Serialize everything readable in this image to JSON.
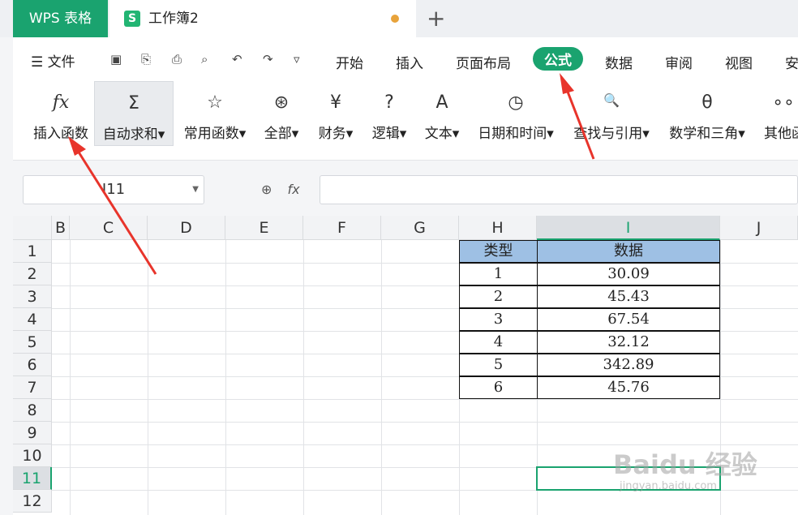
{
  "tabs": {
    "app": "WPS 表格",
    "doc_icon": "S",
    "doc": "工作簿2",
    "new_tab": "+"
  },
  "menubar": {
    "file": "☰ 文件",
    "items": [
      "开始",
      "插入",
      "页面布局",
      "公式",
      "数据",
      "审阅",
      "视图",
      "安"
    ]
  },
  "ribbon": [
    {
      "icon": "fx",
      "label": "插入函数"
    },
    {
      "icon": "Σ",
      "label": "自动求和▾"
    },
    {
      "icon": "☆",
      "label": "常用函数▾"
    },
    {
      "icon": "⊛",
      "label": "全部▾"
    },
    {
      "icon": "¥",
      "label": "财务▾"
    },
    {
      "icon": "?",
      "label": "逻辑▾"
    },
    {
      "icon": "A",
      "label": "文本▾"
    },
    {
      "icon": "◷",
      "label": "日期和时间▾"
    },
    {
      "icon": "🔍",
      "label": "查找与引用▾"
    },
    {
      "icon": "θ",
      "label": "数学和三角▾"
    },
    {
      "icon": "∘∘",
      "label": "其他函"
    }
  ],
  "formula_bar": {
    "name_box": "I11",
    "fx": "fx"
  },
  "columns": [
    "B",
    "C",
    "D",
    "E",
    "F",
    "G",
    "H",
    "I",
    "J"
  ],
  "rows": [
    "1",
    "2",
    "3",
    "4",
    "5",
    "6",
    "7",
    "8",
    "9",
    "10",
    "11",
    "12"
  ],
  "table": {
    "headers": [
      "类型",
      "数据"
    ],
    "rows": [
      [
        "1",
        "30.09"
      ],
      [
        "2",
        "45.43"
      ],
      [
        "3",
        "67.54"
      ],
      [
        "4",
        "32.12"
      ],
      [
        "5",
        "342.89"
      ],
      [
        "6",
        "45.76"
      ]
    ]
  },
  "watermark": {
    "text": "Baidu 经验",
    "sub": "jingyan.baidu.com"
  },
  "colors": {
    "accent": "#1aa36f",
    "header_fill": "#9ec0e4",
    "arrow": "#e8342b"
  }
}
